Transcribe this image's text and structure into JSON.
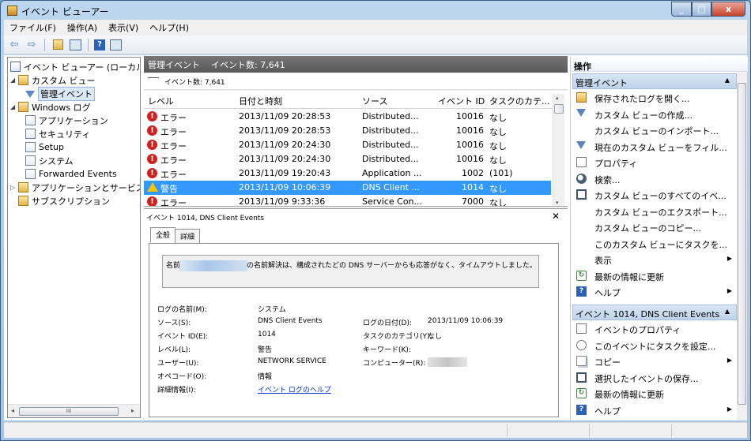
{
  "window": {
    "title": "イベント ビューアー",
    "buttons": {
      "minimize": "_",
      "maximize": "□",
      "close": "x"
    }
  },
  "menu": [
    "ファイル(F)",
    "操作(A)",
    "表示(V)",
    "ヘルプ(H)"
  ],
  "toolbar": {
    "back": "⇦",
    "forward": "⇨",
    "help": "?"
  },
  "tree": {
    "items": [
      {
        "label": "イベント ビューアー (ローカル",
        "icon": "event-viewer-icon"
      },
      {
        "label": "カスタム ビュー",
        "icon": "folder-icon",
        "expander": "◢"
      },
      {
        "label": "管理イベント",
        "icon": "filter-icon"
      },
      {
        "label": "Windows ログ",
        "icon": "folder-icon",
        "expander": "◢"
      },
      {
        "label": "アプリケーション",
        "icon": "log-icon"
      },
      {
        "label": "セキュリティ",
        "icon": "log-icon"
      },
      {
        "label": "Setup",
        "icon": "log-icon"
      },
      {
        "label": "システム",
        "icon": "log-icon"
      },
      {
        "label": "Forwarded Events",
        "icon": "log-icon"
      },
      {
        "label": "アプリケーションとサービス",
        "icon": "folder-icon",
        "expander": "▷"
      },
      {
        "label": "サブスクリプション",
        "icon": "folder-icon"
      }
    ],
    "scroll_left": "◂",
    "scroll_right": "▸",
    "scroll_grip": "III"
  },
  "center": {
    "header_title": "管理イベント",
    "header_count": "イベント数: 7,641",
    "filter_text": "イベント数: 7,641",
    "columns": [
      "レベル",
      "日付と時刻",
      "ソース",
      "イベント ID",
      "タスクのカテ..."
    ],
    "rows": [
      {
        "level": "エラー",
        "datetime": "2013/11/09 20:28:53",
        "source": "Distributed...",
        "event_id": "10016",
        "task": "なし"
      },
      {
        "level": "エラー",
        "datetime": "2013/11/09 20:28:53",
        "source": "Distributed...",
        "event_id": "10016",
        "task": "なし"
      },
      {
        "level": "エラー",
        "datetime": "2013/11/09 20:24:30",
        "source": "Distributed...",
        "event_id": "10016",
        "task": "なし"
      },
      {
        "level": "エラー",
        "datetime": "2013/11/09 20:24:30",
        "source": "Distributed...",
        "event_id": "10016",
        "task": "なし"
      },
      {
        "level": "エラー",
        "datetime": "2013/11/09 19:20:43",
        "source": "Application ...",
        "event_id": "1002",
        "task": "(101)"
      },
      {
        "level": "警告",
        "datetime": "2013/11/09 10:06:39",
        "source": "DNS Client ...",
        "event_id": "1014",
        "task": "なし"
      },
      {
        "level": "エラー",
        "datetime": "2013/11/09 9:33:36",
        "source": "Service Con...",
        "event_id": "7000",
        "task": "なし"
      }
    ],
    "error_glyph": "!",
    "scroll_up": "▴",
    "scroll_down": "▾"
  },
  "detail": {
    "title": "イベント 1014, DNS Client Events",
    "close": "✕",
    "tabs": [
      "全般",
      "詳細"
    ],
    "description_before": "名前",
    "description_after": "の名前解決は、構成されたどの DNS サーバーからも応答がなく、タイムアウトしました。",
    "fields": {
      "log_name_label": "ログの名前(M):",
      "log_name": "システム",
      "source_label": "ソース(S):",
      "source": "DNS Client Events",
      "logged_label": "ログの日付(D):",
      "logged": "2013/11/09 10:06:39",
      "event_id_label": "イベント ID(E):",
      "event_id": "1014",
      "task_label": "タスクのカテゴリ(Y):",
      "task": "なし",
      "level_label": "レベル(L):",
      "level": "警告",
      "keywords_label": "キーワード(K):",
      "keywords": "",
      "user_label": "ユーザー(U):",
      "user": "NETWORK SERVICE",
      "computer_label": "コンピューター(R):",
      "opcode_label": "オペコード(O):",
      "opcode": "情報",
      "more_info_label": "詳細情報(I):",
      "more_info_link": "イベント ログのヘルプ"
    }
  },
  "actions": {
    "title": "操作",
    "section1_title": "管理イベント",
    "section1_items": [
      {
        "label": "保存されたログを開く...",
        "icon": "open-log-icon"
      },
      {
        "label": "カスタム ビューの作成...",
        "icon": "filter-icon"
      },
      {
        "label": "カスタム ビューのインポート...",
        "icon": ""
      },
      {
        "label": "現在のカスタム ビューをフィル...",
        "icon": "filter-icon"
      },
      {
        "label": "プロパティ",
        "icon": "properties-icon"
      },
      {
        "label": "検索...",
        "icon": "find-icon"
      },
      {
        "label": "カスタム ビューのすべてのイベ...",
        "icon": "save-icon"
      },
      {
        "label": "カスタム ビューのエクスポート...",
        "icon": ""
      },
      {
        "label": "カスタム ビューのコピー...",
        "icon": ""
      },
      {
        "label": "このカスタム ビューにタスクを...",
        "icon": ""
      },
      {
        "label": "表示",
        "icon": "",
        "submenu": true
      },
      {
        "label": "最新の情報に更新",
        "icon": "refresh-icon"
      },
      {
        "label": "ヘルプ",
        "icon": "help-icon",
        "submenu": true
      }
    ],
    "section2_title": "イベント 1014, DNS Client Events",
    "section2_items": [
      {
        "label": "イベントのプロパティ",
        "icon": "properties-icon"
      },
      {
        "label": "このイベントにタスクを設定...",
        "icon": "task-icon"
      },
      {
        "label": "コピー",
        "icon": "copy-icon",
        "submenu": true
      },
      {
        "label": "選択したイベントの保存...",
        "icon": "save-icon"
      },
      {
        "label": "最新の情報に更新",
        "icon": "refresh-icon"
      },
      {
        "label": "ヘルプ",
        "icon": "help-icon",
        "submenu": true
      }
    ],
    "collapse_glyph": "▲",
    "submenu_glyph": "▶",
    "refresh_glyph": "↻",
    "help_glyph": "?"
  }
}
